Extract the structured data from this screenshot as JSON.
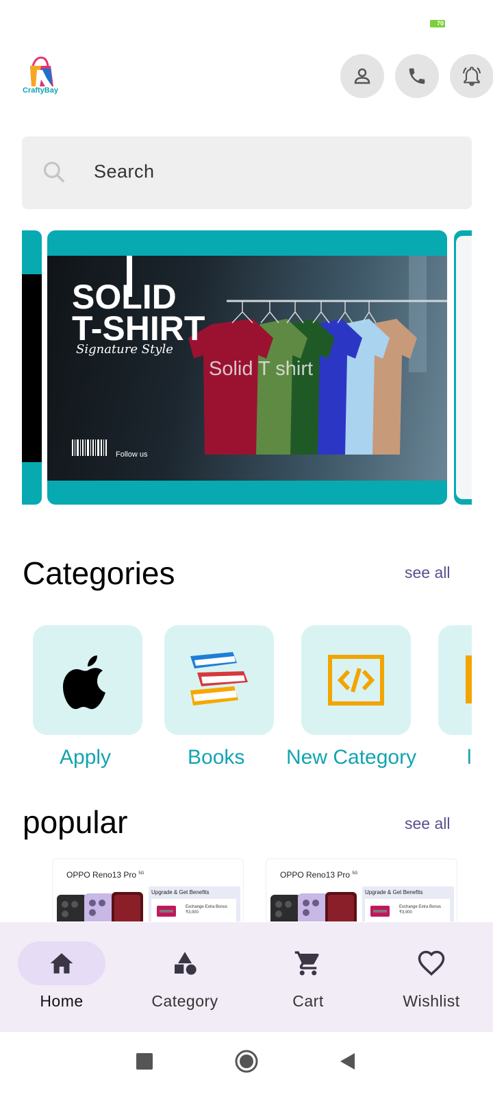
{
  "status_bar": {
    "battery": "70",
    "battery_color": "#7ccf3a"
  },
  "header": {
    "logo_text": "CraftyBay",
    "buttons": [
      {
        "icon": "person-icon"
      },
      {
        "icon": "phone-icon"
      },
      {
        "icon": "bell-icon"
      }
    ]
  },
  "search": {
    "placeholder": "Search"
  },
  "carousel": {
    "accent_color": "#07aab1",
    "caption": "Solid T shirt",
    "banner": {
      "headline_1": "SOLID",
      "headline_2": "T-SHIRT",
      "script": "Signature Style",
      "social": "Follow us"
    }
  },
  "categories": {
    "title": "Categories",
    "see_all": "see all",
    "items": [
      {
        "label": "Apply",
        "icon": "apple-icon"
      },
      {
        "label": "Books",
        "icon": "books-icon"
      },
      {
        "label": "New Category",
        "icon": "code-icon"
      },
      {
        "label": "l",
        "icon": "partial-icon"
      }
    ]
  },
  "popular": {
    "title": "popular",
    "see_all": "see all",
    "products": [
      {
        "title": "OPPO Reno13 Pro",
        "badge": "5G",
        "promo_title": "Upgrade & Get Benefits",
        "promo_line1": "Exchange Extra Bonus",
        "promo_line2": "₹3,000"
      },
      {
        "title": "OPPO Reno13 Pro",
        "badge": "5G",
        "promo_title": "Upgrade & Get Benefits",
        "promo_line1": "Exchange Extra Bonus",
        "promo_line2": "₹3,000"
      }
    ]
  },
  "bottom_nav": {
    "items": [
      {
        "label": "Home",
        "icon": "home-icon",
        "active": true
      },
      {
        "label": "Category",
        "icon": "category-icon",
        "active": false
      },
      {
        "label": "Cart",
        "icon": "cart-icon",
        "active": false
      },
      {
        "label": "Wishlist",
        "icon": "heart-icon",
        "active": false
      }
    ],
    "active_color": "#e6dcf6",
    "background": "#f2ecf6"
  },
  "system_nav": {
    "buttons": [
      "recents-button",
      "home-button",
      "back-button"
    ]
  }
}
